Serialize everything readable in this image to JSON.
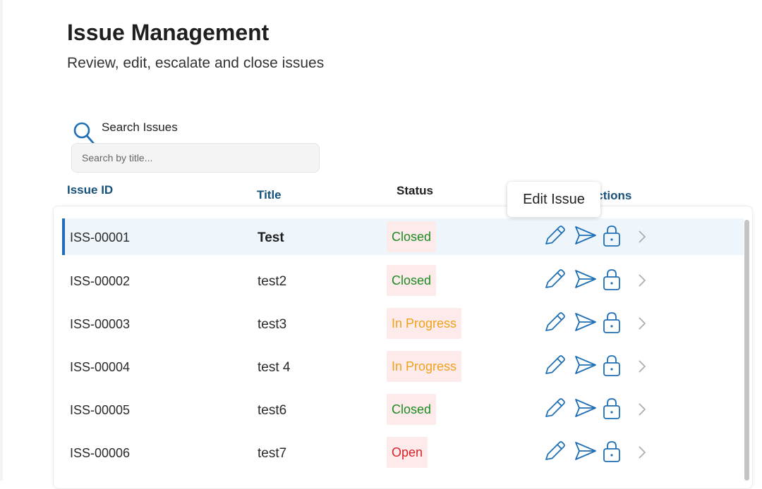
{
  "page": {
    "title": "Issue Management",
    "subtitle": "Review, edit, escalate and close issues"
  },
  "search": {
    "label": "Search Issues",
    "placeholder": "Search by title...",
    "icon": "search-icon"
  },
  "table": {
    "columns": {
      "id": "Issue ID",
      "title": "Title",
      "status": "Status",
      "actions": "Actions"
    },
    "rows": [
      {
        "id": "ISS-00001",
        "title": "Test",
        "status": "Closed"
      },
      {
        "id": "ISS-00002",
        "title": "test2",
        "status": "Closed"
      },
      {
        "id": "ISS-00003",
        "title": "test3",
        "status": "In Progress"
      },
      {
        "id": "ISS-00004",
        "title": "test 4",
        "status": "In Progress"
      },
      {
        "id": "ISS-00005",
        "title": "test6",
        "status": "Closed"
      },
      {
        "id": "ISS-00006",
        "title": "test7",
        "status": "Open"
      }
    ],
    "action_icons": [
      "pencil-icon",
      "send-icon",
      "lock-icon",
      "chevron-right-icon"
    ]
  },
  "tooltip": {
    "text": "Edit Issue"
  },
  "colors": {
    "accent": "#1e6fb5",
    "header_text": "#17507a",
    "status_closed": "#1f8a22",
    "status_in_progress": "#f0a21b",
    "status_open": "#d8232a",
    "status_background": "#fdeaea",
    "selected_row": "#eef6fc"
  }
}
